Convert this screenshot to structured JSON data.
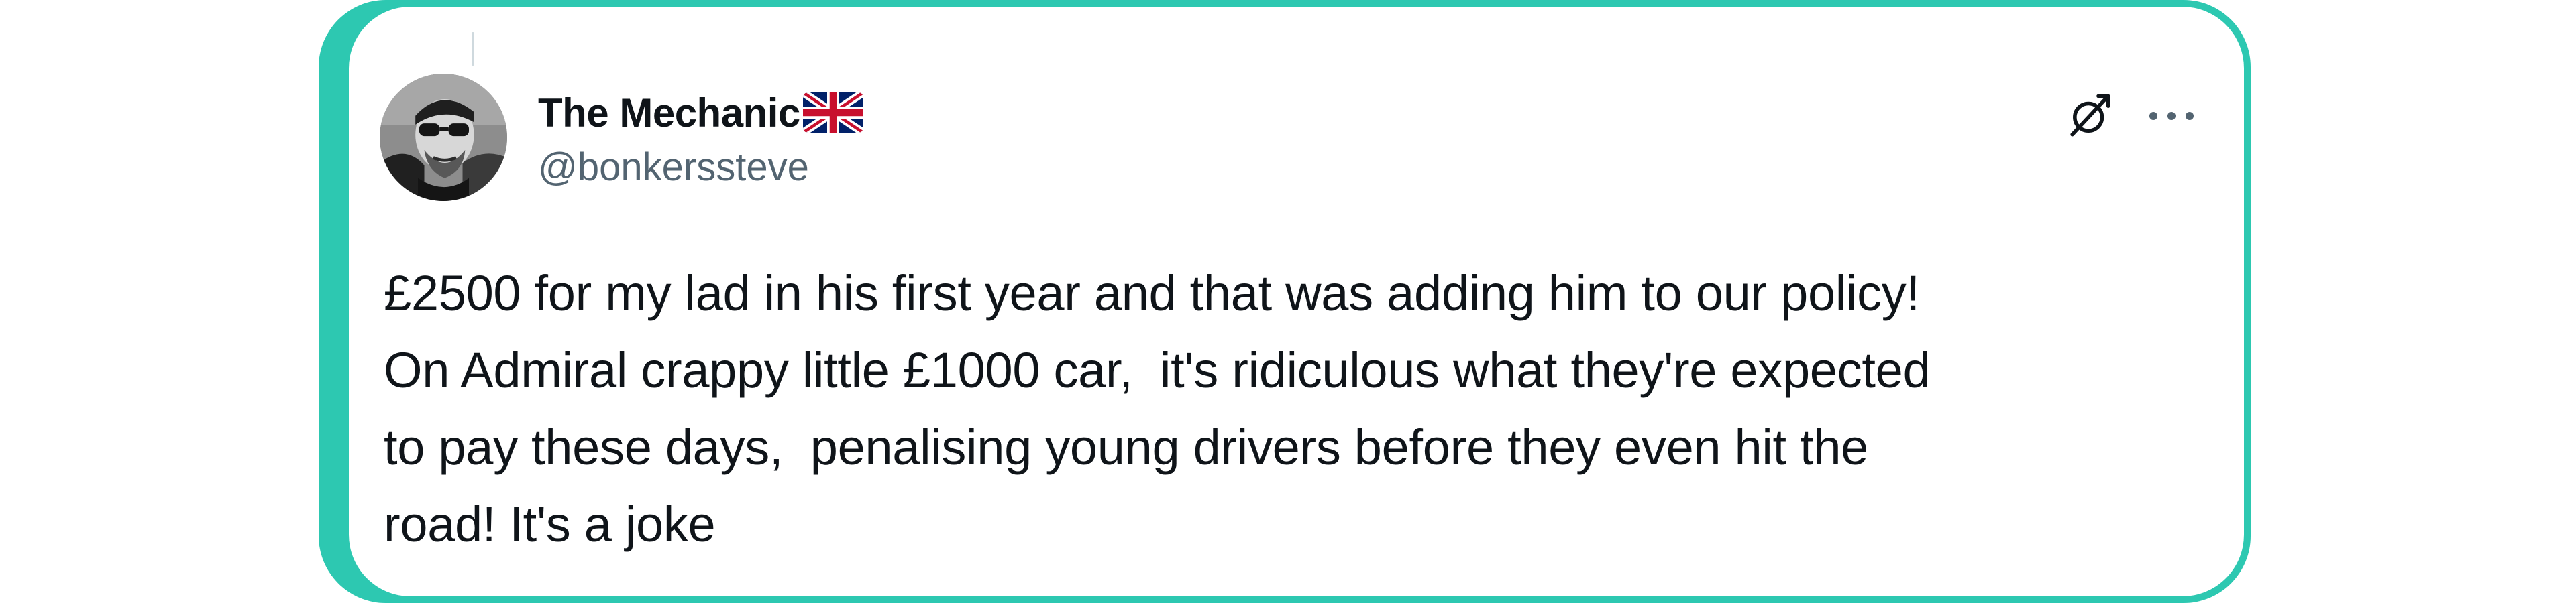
{
  "author": {
    "display_name": "The Mechanic",
    "flag_icon": "uk-flag-icon",
    "handle": "@bonkerssteve",
    "avatar_icon": "avatar-icon"
  },
  "actions": {
    "grok_icon": "grok-icon",
    "more_icon": "more-dots-icon"
  },
  "tweet": {
    "lines": [
      "£2500 for my lad in his first year and that was adding him to our policy!",
      "On Admiral crappy little £1000 car,  it's ridiculous what they're expected",
      "to pay these days,  penalising young drivers before they even hit the",
      "road! It's a joke"
    ]
  },
  "colors": {
    "frame": "#2dc8b1",
    "text": "#0f1419",
    "secondary_text": "#536471",
    "icon": "#0f1419"
  }
}
